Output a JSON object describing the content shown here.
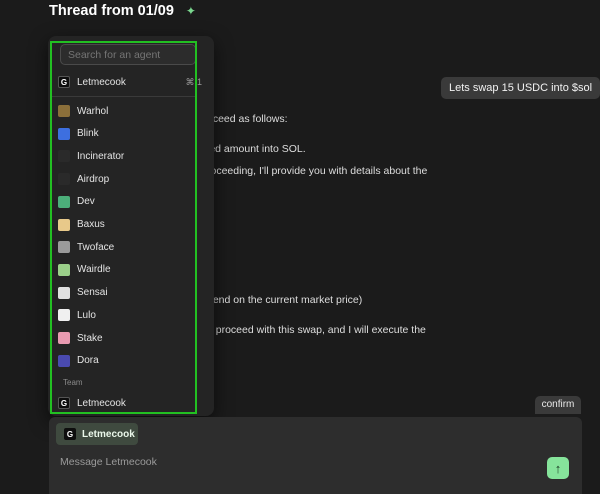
{
  "thread": {
    "title": "Thread from 01/09",
    "sparkle_icon": "sparkle-icon"
  },
  "messages": {
    "user_message": "Lets swap 15 USDC into $sol",
    "reply_lines": [
      "oceed as follows:",
      "ied amount into SOL.",
      "roceeding, I'll provide you with details about the",
      "pend on the current market price)",
      "o proceed with this swap, and I will execute the"
    ],
    "confirm": "confirm"
  },
  "agent_menu": {
    "search_placeholder": "Search for an agent",
    "current": {
      "label": "Letmecook",
      "shortcut": "⌘ 1"
    },
    "agents": [
      {
        "label": "Warhol",
        "icon": "warhol-icon",
        "color": "#8b6f3a"
      },
      {
        "label": "Blink",
        "icon": "blink-icon",
        "color": "#3d6fe0"
      },
      {
        "label": "Incinerator",
        "icon": "flame-icon",
        "color": "#2a2a2a"
      },
      {
        "label": "Airdrop",
        "icon": "parachute-icon",
        "color": "#2a2a2a"
      },
      {
        "label": "Dev",
        "icon": "pill-icon",
        "color": "#4caf7a"
      },
      {
        "label": "Baxus",
        "icon": "baxus-icon",
        "color": "#e8c98a"
      },
      {
        "label": "Twoface",
        "icon": "twoface-icon",
        "color": "#9a9a9a"
      },
      {
        "label": "Wairdle",
        "icon": "wairdle-icon",
        "color": "#9bd08a"
      },
      {
        "label": "Sensai",
        "icon": "sensai-icon",
        "color": "#e0e0e0"
      },
      {
        "label": "Lulo",
        "icon": "lulo-icon",
        "color": "#f0f0f0"
      },
      {
        "label": "Stake",
        "icon": "stake-icon",
        "color": "#e89ab0"
      },
      {
        "label": "Dora",
        "icon": "dora-icon",
        "color": "#4a4ab0"
      }
    ],
    "team_label": "Team",
    "team_agent": {
      "label": "Letmecook"
    }
  },
  "composer": {
    "selected_agent": "Letmecook",
    "placeholder": "Message Letmecook",
    "send_icon": "arrow-up-icon"
  },
  "colors": {
    "highlight": "#22c022",
    "send": "#86e49b"
  }
}
